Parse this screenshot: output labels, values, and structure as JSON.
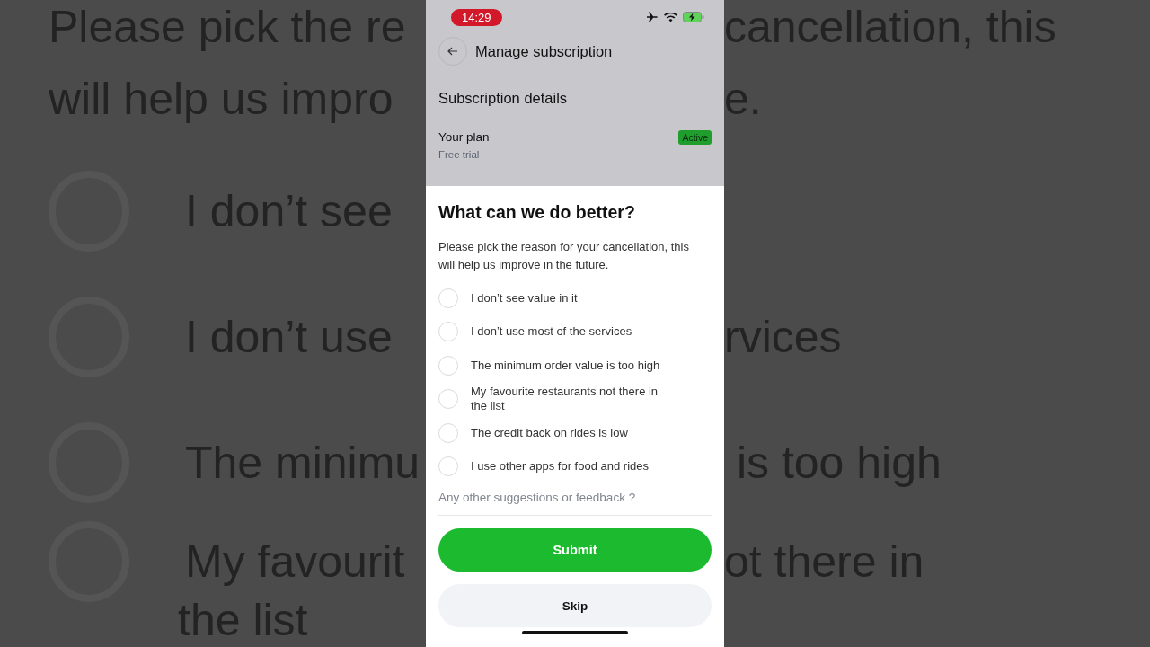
{
  "background": {
    "left": [
      {
        "kind": "line",
        "text": "Please pick the re"
      },
      {
        "kind": "line",
        "text": "will help us impro"
      },
      {
        "kind": "option",
        "text": "I don’t see"
      },
      {
        "kind": "option",
        "text": "I don’t use"
      },
      {
        "kind": "option",
        "text": "The minimu"
      },
      {
        "kind": "option",
        "text": "My favourit"
      },
      {
        "kind": "cut",
        "text": "the list"
      }
    ],
    "right": [
      {
        "kind": "line",
        "text": "cancellation, this"
      },
      {
        "kind": "line",
        "text": "e."
      },
      {
        "kind": "gap"
      },
      {
        "kind": "line",
        "text": "rvices"
      },
      {
        "kind": "line",
        "text": " is too high"
      },
      {
        "kind": "line",
        "text": "ot there in"
      }
    ]
  },
  "status_bar": {
    "time": "14:29"
  },
  "header": {
    "title": "Manage subscription"
  },
  "details": {
    "heading": "Subscription details",
    "plan_label": "Your plan",
    "plan_value": "Free trial",
    "badge": "Active"
  },
  "sheet": {
    "title": "What can we do better?",
    "description": "Please pick the reason for your cancellation, this will help us improve in the future.",
    "reasons": [
      {
        "label": "I don’t see value in it",
        "selected": false
      },
      {
        "label": "I don’t use most of the services",
        "selected": false
      },
      {
        "label": "The minimum order value is too high",
        "selected": false
      },
      {
        "label": "My favourite restaurants not there in the list",
        "selected": false
      },
      {
        "label": "The credit back on rides is low",
        "selected": false
      },
      {
        "label": "I use other apps for food and rides",
        "selected": false
      }
    ],
    "feedback": {
      "placeholder": "Any other suggestions or feedback ?"
    },
    "buttons": [
      {
        "kind": "primary",
        "label": "Submit"
      },
      {
        "kind": "secondary",
        "label": "Skip"
      }
    ]
  }
}
